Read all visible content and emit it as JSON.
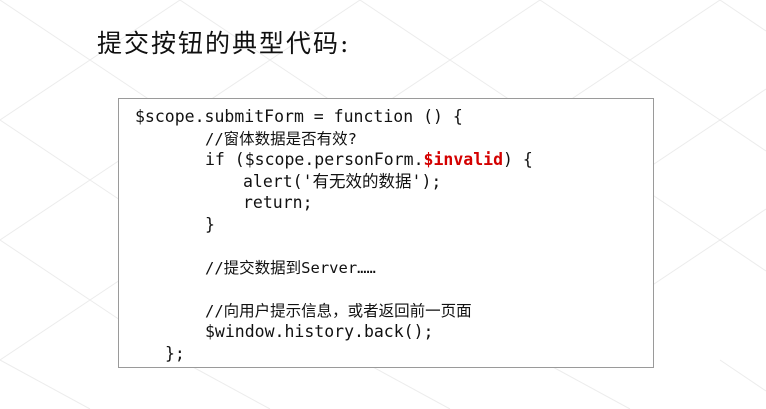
{
  "slide": {
    "title": "提交按钮的典型代码:",
    "code": {
      "line1": "$scope.submitForm = function () {",
      "line2": "//窗体数据是否有效?",
      "line3_prefix": "if ($scope.personForm.",
      "line3_highlight": "$invalid",
      "line3_suffix": ") {",
      "line4": "alert('有无效的数据');",
      "line5": "return;",
      "line6": "}",
      "line7": "//提交数据到Server……",
      "line8": "//向用户提示信息，或者返回前一页面",
      "line9": "$window.history.back();",
      "line10": "};"
    },
    "colors": {
      "highlight": "#d40000",
      "pattern_line": "#ececec",
      "box_border": "#9a9a9a"
    }
  }
}
